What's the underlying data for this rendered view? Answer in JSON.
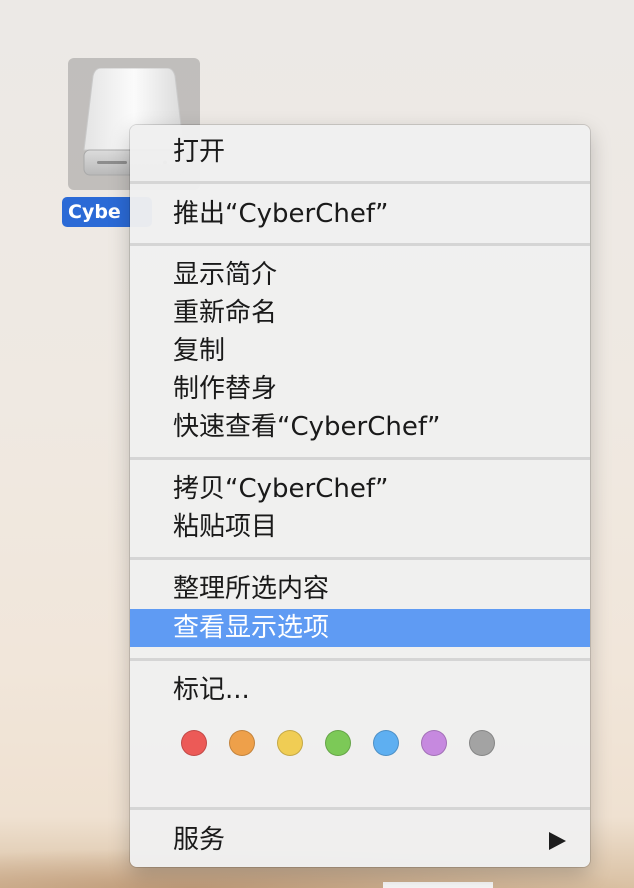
{
  "desktop": {
    "drive_name": "Cybe",
    "drive_icon": "external-drive-icon"
  },
  "context_menu": {
    "open": "打开",
    "eject": "推出“CyberChef”",
    "get_info": "显示简介",
    "rename": "重新命名",
    "duplicate": "复制",
    "make_alias": "制作替身",
    "quick_look": "快速查看“CyberChef”",
    "copy": "拷贝“CyberChef”",
    "paste": "粘贴项目",
    "clean_up": "整理所选内容",
    "view_options": "查看显示选项",
    "tags": "标记...",
    "tag_colors": [
      {
        "name": "red",
        "color": "#ec5a57"
      },
      {
        "name": "orange",
        "color": "#eea04a"
      },
      {
        "name": "yellow",
        "color": "#f0cd54"
      },
      {
        "name": "green",
        "color": "#7cc957"
      },
      {
        "name": "blue",
        "color": "#5eaff1"
      },
      {
        "name": "purple",
        "color": "#c689df"
      },
      {
        "name": "gray",
        "color": "#a3a3a3"
      }
    ],
    "services": "服务",
    "services_icon": "submenu-arrow-icon",
    "highlighted_item": "查看显示选项"
  }
}
